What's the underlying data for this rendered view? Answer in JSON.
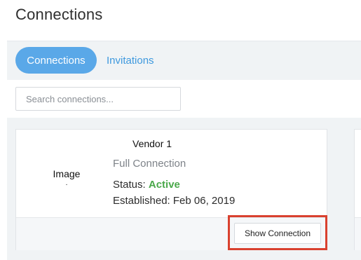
{
  "page": {
    "title": "Connections"
  },
  "tabs": [
    {
      "label": "Connections",
      "active": true
    },
    {
      "label": "Invitations",
      "active": false
    }
  ],
  "search": {
    "placeholder": "Search connections..."
  },
  "cards": [
    {
      "image_alt": "Image",
      "image_sub": ".",
      "vendor_name": "Vendor 1",
      "connection_type": "Full Connection",
      "status_label": "Status:",
      "status_value": "Active",
      "established_label": "Established:",
      "established_date": "Feb 06, 2019",
      "action_label": "Show Connection"
    }
  ],
  "colors": {
    "accent": "#5aa8e8",
    "link": "#3e99de",
    "status_active": "#4aa84a",
    "highlight": "#d9412f"
  }
}
